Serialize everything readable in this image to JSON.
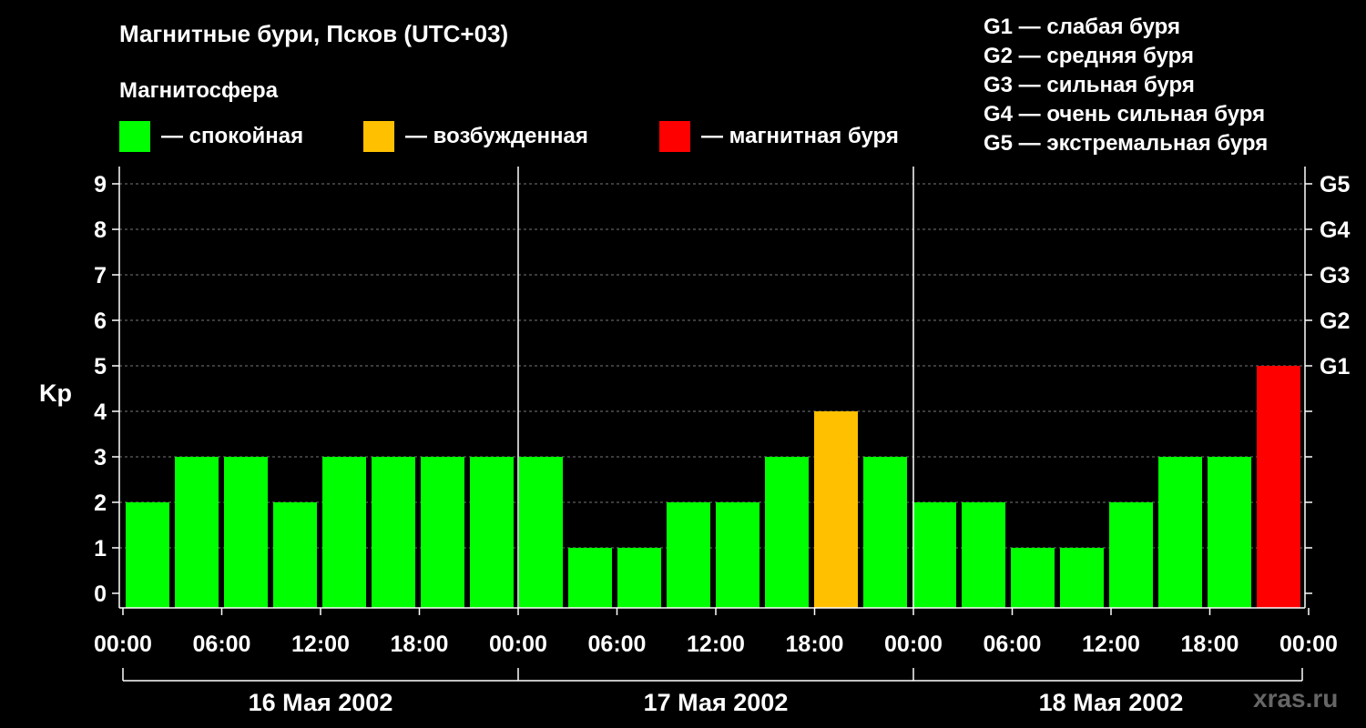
{
  "title": "Магнитные бури, Псков (UTC+03)",
  "subtitle": "Магнитосфера",
  "legend": [
    {
      "label": "— спокойная",
      "color": "#00ff00"
    },
    {
      "label": "— возбужденная",
      "color": "#ffc000"
    },
    {
      "label": "— магнитная буря",
      "color": "#ff0000"
    }
  ],
  "g_scale": [
    "G1 — слабая буря",
    "G2 — средняя буря",
    "G3 — сильная буря",
    "G4 — очень сильная буря",
    "G5 — экстремальная буря"
  ],
  "watermark": "xras.ru",
  "chart_data": {
    "type": "bar",
    "ylabel": "Kp",
    "ylim": [
      0,
      9
    ],
    "yticks": [
      "0",
      "1",
      "2",
      "3",
      "4",
      "5",
      "6",
      "7",
      "8",
      "9"
    ],
    "right_axis_labels": [
      {
        "kp": 5,
        "label": "G1"
      },
      {
        "kp": 6,
        "label": "G2"
      },
      {
        "kp": 7,
        "label": "G3"
      },
      {
        "kp": 8,
        "label": "G4"
      },
      {
        "kp": 9,
        "label": "G5"
      }
    ],
    "xticks": [
      "00:00",
      "06:00",
      "12:00",
      "18:00",
      "00:00",
      "06:00",
      "12:00",
      "18:00",
      "00:00",
      "06:00",
      "12:00",
      "18:00",
      "00:00"
    ],
    "days": [
      "16 Мая 2002",
      "17 Мая 2002",
      "18 Мая 2002"
    ],
    "grid": true,
    "values": [
      2,
      3,
      3,
      2,
      3,
      3,
      3,
      3,
      3,
      1,
      1,
      2,
      2,
      3,
      4,
      3,
      2,
      2,
      1,
      1,
      2,
      3,
      3,
      5
    ],
    "colors": [
      "#00ff00",
      "#00ff00",
      "#00ff00",
      "#00ff00",
      "#00ff00",
      "#00ff00",
      "#00ff00",
      "#00ff00",
      "#00ff00",
      "#00ff00",
      "#00ff00",
      "#00ff00",
      "#00ff00",
      "#00ff00",
      "#ffc000",
      "#00ff00",
      "#00ff00",
      "#00ff00",
      "#00ff00",
      "#00ff00",
      "#00ff00",
      "#00ff00",
      "#00ff00",
      "#ff0000"
    ]
  }
}
